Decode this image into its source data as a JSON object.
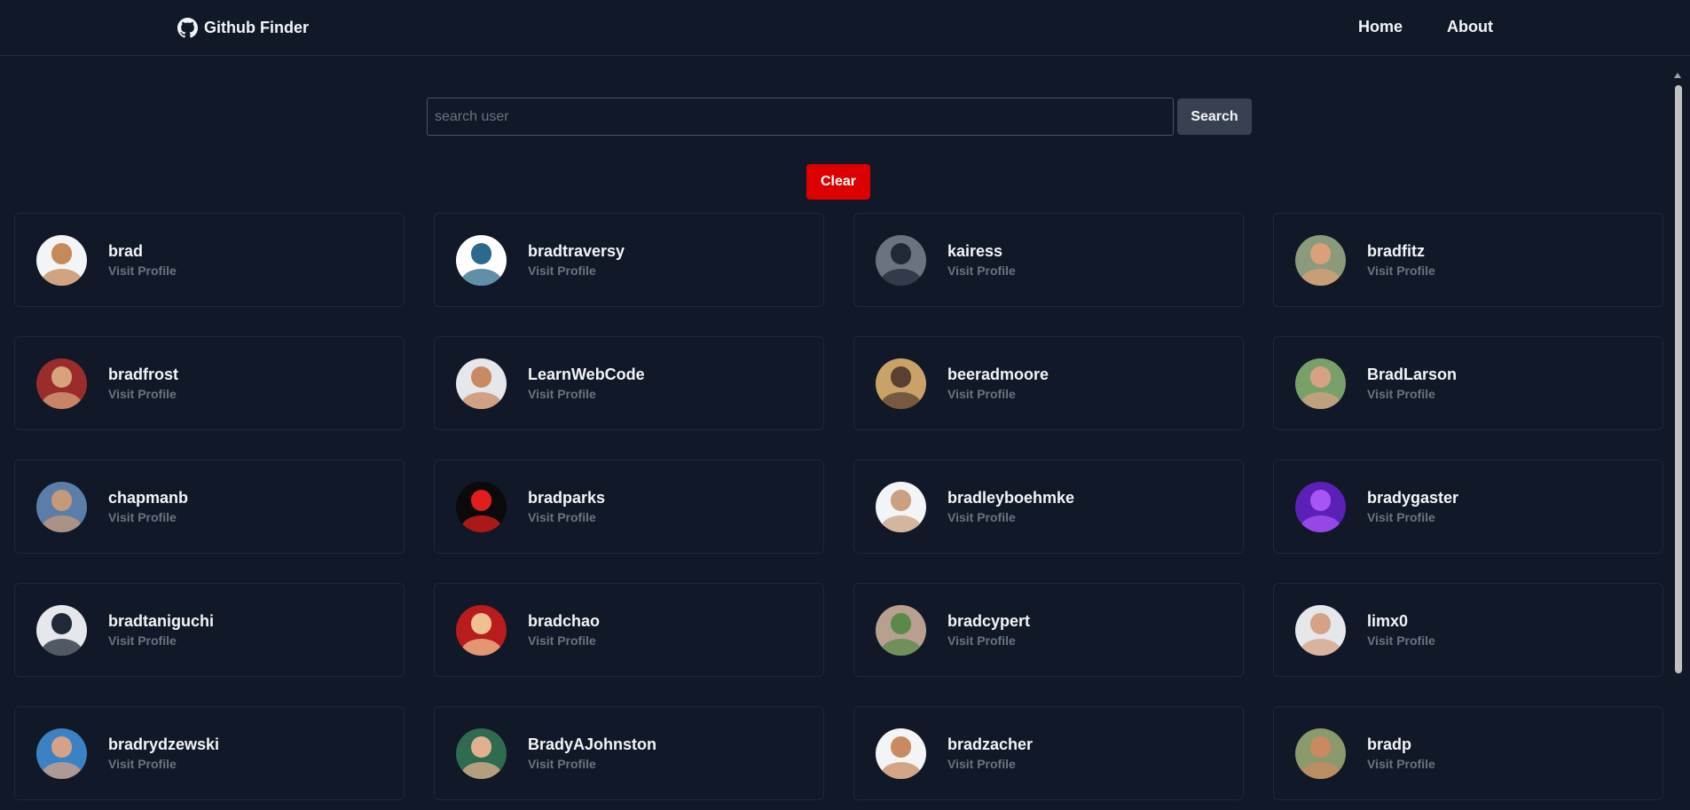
{
  "navbar": {
    "brand": "Github Finder",
    "links": [
      "Home",
      "About"
    ]
  },
  "search": {
    "placeholder": "search user",
    "value": "",
    "button_label": "Search",
    "clear_label": "Clear"
  },
  "users": [
    {
      "login": "brad",
      "link_label": "Visit Profile",
      "avatar_bg": "#f3f4f6",
      "avatar_fg": "#c48a5a"
    },
    {
      "login": "bradtraversy",
      "link_label": "Visit Profile",
      "avatar_bg": "#ffffff",
      "avatar_fg": "#2b6a8e"
    },
    {
      "login": "kairess",
      "link_label": "Visit Profile",
      "avatar_bg": "#6b7280",
      "avatar_fg": "#1f2937"
    },
    {
      "login": "bradfitz",
      "link_label": "Visit Profile",
      "avatar_bg": "#8a9a7a",
      "avatar_fg": "#d9a07a"
    },
    {
      "login": "bradfrost",
      "link_label": "Visit Profile",
      "avatar_bg": "#9b2c2c",
      "avatar_fg": "#d8a27a"
    },
    {
      "login": "LearnWebCode",
      "link_label": "Visit Profile",
      "avatar_bg": "#e5e7eb",
      "avatar_fg": "#c98a62"
    },
    {
      "login": "beeradmoore",
      "link_label": "Visit Profile",
      "avatar_bg": "#c9a26a",
      "avatar_fg": "#5a4030"
    },
    {
      "login": "BradLarson",
      "link_label": "Visit Profile",
      "avatar_bg": "#7aa06a",
      "avatar_fg": "#d6a285"
    },
    {
      "login": "chapmanb",
      "link_label": "Visit Profile",
      "avatar_bg": "#5b7ea8",
      "avatar_fg": "#c49a7a"
    },
    {
      "login": "bradparks",
      "link_label": "Visit Profile",
      "avatar_bg": "#0a0a0a",
      "avatar_fg": "#e11d1d"
    },
    {
      "login": "bradleyboehmke",
      "link_label": "Visit Profile",
      "avatar_bg": "#f3f4f6",
      "avatar_fg": "#c9a080"
    },
    {
      "login": "bradygaster",
      "link_label": "Visit Profile",
      "avatar_bg": "#5b21b6",
      "avatar_fg": "#a855f7"
    },
    {
      "login": "bradtaniguchi",
      "link_label": "Visit Profile",
      "avatar_bg": "#e5e7eb",
      "avatar_fg": "#1f2937"
    },
    {
      "login": "bradchao",
      "link_label": "Visit Profile",
      "avatar_bg": "#b91c1c",
      "avatar_fg": "#f0c090"
    },
    {
      "login": "bradcypert",
      "link_label": "Visit Profile",
      "avatar_bg": "#b8a090",
      "avatar_fg": "#5a8a4a"
    },
    {
      "login": "limx0",
      "link_label": "Visit Profile",
      "avatar_bg": "#e5e7eb",
      "avatar_fg": "#d6a285"
    },
    {
      "login": "bradrydzewski",
      "link_label": "Visit Profile",
      "avatar_bg": "#3b82c4",
      "avatar_fg": "#d6a285"
    },
    {
      "login": "BradyAJohnston",
      "link_label": "Visit Profile",
      "avatar_bg": "#2f6b4f",
      "avatar_fg": "#e0b090"
    },
    {
      "login": "bradzacher",
      "link_label": "Visit Profile",
      "avatar_bg": "#f3f4f6",
      "avatar_fg": "#c98a62"
    },
    {
      "login": "bradp",
      "link_label": "Visit Profile",
      "avatar_bg": "#8a9a6a",
      "avatar_fg": "#c98a62"
    }
  ],
  "colors": {
    "background": "#111827",
    "clear_button": "#dc0000",
    "search_button": "#374151",
    "muted_text": "#6b7280"
  }
}
